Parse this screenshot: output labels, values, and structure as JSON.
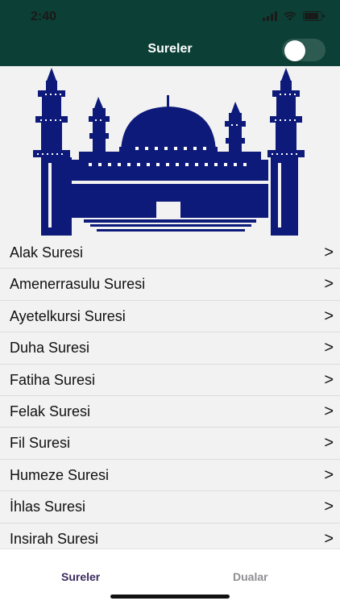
{
  "status": {
    "time": "2:40"
  },
  "nav": {
    "title": "Sureler",
    "toggle_on": false
  },
  "banner": {
    "icon": "mosque-icon",
    "color": "#0d1a7a"
  },
  "list": {
    "items": [
      {
        "label": "Alak Suresi",
        "chevron": ">"
      },
      {
        "label": "Amenerrasulu Suresi",
        "chevron": ">"
      },
      {
        "label": "Ayetelkursi Suresi",
        "chevron": ">"
      },
      {
        "label": "Duha Suresi",
        "chevron": ">"
      },
      {
        "label": "Fatiha Suresi",
        "chevron": ">"
      },
      {
        "label": "Felak Suresi",
        "chevron": ">"
      },
      {
        "label": "Fil Suresi",
        "chevron": ">"
      },
      {
        "label": "Humeze Suresi",
        "chevron": ">"
      },
      {
        "label": "İhlas Suresi",
        "chevron": ">"
      },
      {
        "label": "Insirah Suresi",
        "chevron": ">"
      }
    ]
  },
  "tabs": [
    {
      "label": "Sureler",
      "active": true
    },
    {
      "label": "Dualar",
      "active": false
    }
  ],
  "colors": {
    "header": "#0c3f35",
    "active_tab": "#3a2a5e",
    "inactive_tab": "#8e8e93"
  }
}
